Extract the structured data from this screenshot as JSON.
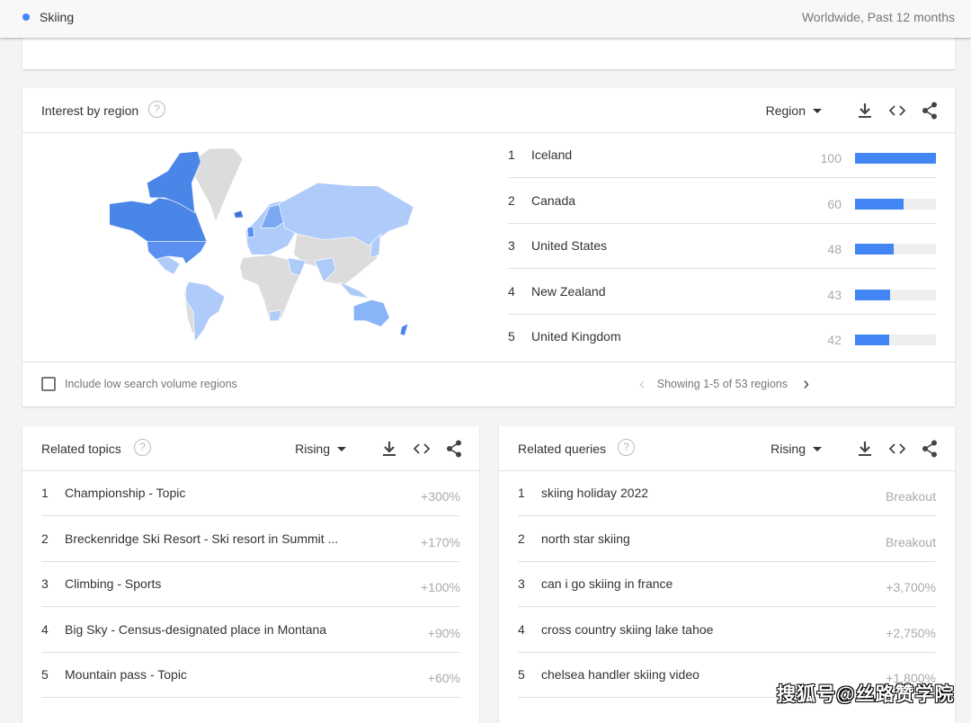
{
  "topbar": {
    "term": "Skiing",
    "scope": "Worldwide, Past 12 months"
  },
  "colors": {
    "accent": "#4285f4",
    "map_max": "#3d73d9",
    "map_mid": "#5b8ff0",
    "map_low": "#aecbfa",
    "map_none": "#dcdcdc"
  },
  "region": {
    "title": "Interest by region",
    "help": "?",
    "selector": "Region",
    "items": [
      {
        "rank": "1",
        "name": "Iceland",
        "value": 100
      },
      {
        "rank": "2",
        "name": "Canada",
        "value": 60
      },
      {
        "rank": "3",
        "name": "United States",
        "value": 48
      },
      {
        "rank": "4",
        "name": "New Zealand",
        "value": 43
      },
      {
        "rank": "5",
        "name": "United Kingdom",
        "value": 42
      }
    ],
    "checkbox_label": "Include low search volume regions",
    "pager": "Showing 1-5 of 53 regions",
    "prev": "‹",
    "next": "›"
  },
  "topics": {
    "title": "Related topics",
    "help": "?",
    "selector": "Rising",
    "items": [
      {
        "rank": "1",
        "label": "Championship - Topic",
        "value": "+300%"
      },
      {
        "rank": "2",
        "label": "Breckenridge Ski Resort - Ski resort in Summit ...",
        "value": "+170%"
      },
      {
        "rank": "3",
        "label": "Climbing - Sports",
        "value": "+100%"
      },
      {
        "rank": "4",
        "label": "Big Sky - Census-designated place in Montana",
        "value": "+90%"
      },
      {
        "rank": "5",
        "label": "Mountain pass - Topic",
        "value": "+60%"
      }
    ]
  },
  "queries": {
    "title": "Related queries",
    "help": "?",
    "selector": "Rising",
    "items": [
      {
        "rank": "1",
        "label": "skiing holiday 2022",
        "value": "Breakout"
      },
      {
        "rank": "2",
        "label": "north star skiing",
        "value": "Breakout"
      },
      {
        "rank": "3",
        "label": "can i go skiing in france",
        "value": "+3,700%"
      },
      {
        "rank": "4",
        "label": "cross country skiing lake tahoe",
        "value": "+2,750%"
      },
      {
        "rank": "5",
        "label": "chelsea handler skiing video",
        "value": "+1,800%"
      }
    ]
  },
  "watermark": "搜狐号@丝路赞学院"
}
